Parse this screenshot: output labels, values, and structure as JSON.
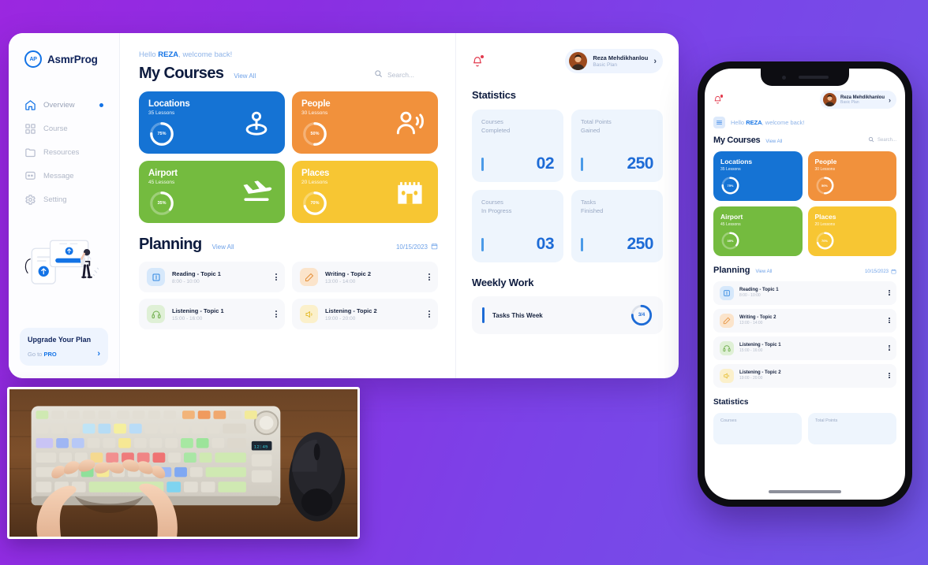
{
  "background": {
    "gradient_from": "#9b27e0",
    "gradient_to": "#6f55e6"
  },
  "app": {
    "brand": {
      "mark": "AP",
      "name": "AsmrProg"
    },
    "sidebar": {
      "items": [
        {
          "label": "Overview",
          "icon": "home-icon",
          "active": true
        },
        {
          "label": "Course",
          "icon": "grid-icon",
          "active": false
        },
        {
          "label": "Resources",
          "icon": "folder-icon",
          "active": false
        },
        {
          "label": "Message",
          "icon": "message-icon",
          "active": false
        },
        {
          "label": "Setting",
          "icon": "gear-icon",
          "active": false
        }
      ],
      "upgrade": {
        "title": "Upgrade Your Plan",
        "cta_prefix": "Go to ",
        "cta_strong": "PRO",
        "chevron": "›"
      }
    },
    "main": {
      "greeting_prefix": "Hello ",
      "greeting_name": "REZA",
      "greeting_suffix": ", welcome back!",
      "courses_title": "My Courses",
      "view_all": "View All",
      "search_placeholder": "Search...",
      "search_value": "",
      "courses": [
        {
          "title": "Locations",
          "lessons": "35 Lessons",
          "percent": 75,
          "percent_label": "75%",
          "color": "#1573d4",
          "icon": "location-pin-icon"
        },
        {
          "title": "People",
          "lessons": "30 Lessons",
          "percent": 50,
          "percent_label": "50%",
          "color": "#f1913c",
          "icon": "person-speaking-icon"
        },
        {
          "title": "Airport",
          "lessons": "45 Lessons",
          "percent": 35,
          "percent_label": "35%",
          "color": "#74bb3f",
          "icon": "airplane-landing-icon"
        },
        {
          "title": "Places",
          "lessons": "20 Lessons",
          "percent": 70,
          "percent_label": "70%",
          "color": "#f7c633",
          "icon": "castle-icon"
        }
      ],
      "planning_title": "Planning",
      "planning_view_all": "View All",
      "planning_date": "10/15/2023",
      "tasks": [
        {
          "name": "Reading - Topic 1",
          "time": "8:00 - 10:00",
          "icon": "book-icon",
          "icon_bg": "#d6e8fb",
          "icon_color": "#2f86e0"
        },
        {
          "name": "Writing - Topic 2",
          "time": "13:00 - 14:00",
          "icon": "pencil-icon",
          "icon_bg": "#fbe4cb",
          "icon_color": "#e4903c"
        },
        {
          "name": "Listening - Topic 1",
          "time": "15:00 - 16:00",
          "icon": "headphone-icon",
          "icon_bg": "#dff0d6",
          "icon_color": "#6fae4c"
        },
        {
          "name": "Listening - Topic 2",
          "time": "19:00 - 20:00",
          "icon": "speaker-icon",
          "icon_bg": "#fbf0cb",
          "icon_color": "#e5be34"
        }
      ]
    },
    "stats": {
      "bell": "notification-bell-icon",
      "profile": {
        "name": "Reza Mehdikhanlou",
        "plan": "Basic Plan",
        "chevron": "›"
      },
      "title": "Statistics",
      "cards": [
        {
          "label": "Courses\nCompleted",
          "value": "02"
        },
        {
          "label": "Total Points\nGained",
          "value": "250"
        },
        {
          "label": "Courses\nIn Progress",
          "value": "03"
        },
        {
          "label": "Tasks\nFinished",
          "value": "250"
        }
      ],
      "weekly_title": "Weekly Work",
      "weekly": {
        "label": "Tasks This Week",
        "value": "3/4",
        "percent": 75
      }
    }
  },
  "phone": {
    "greeting_prefix": "Hello ",
    "greeting_name": "REZA",
    "greeting_suffix": ", welcome back!",
    "menu_icon": "hamburger-menu-icon",
    "profile": {
      "name": "Reza Mehdikhanlou",
      "plan": "Basic Plan",
      "chevron": "›"
    },
    "courses_title": "My Courses",
    "view_all": "View All",
    "search_placeholder": "Search...",
    "planning_title": "Planning",
    "planning_date": "10/15/2023",
    "stats_title": "Statistics",
    "stat_labels": [
      "Courses",
      "Total Points"
    ]
  },
  "webcam": {
    "caption": "hands typing on rgb backlit mechanical keyboard with mouse on wooden desk"
  }
}
